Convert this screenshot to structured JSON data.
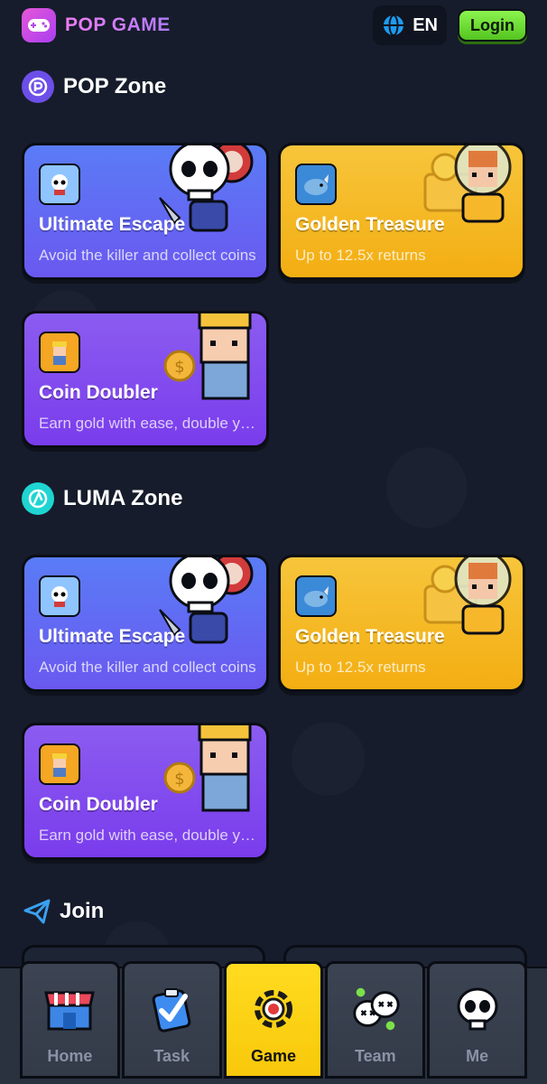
{
  "header": {
    "brand_title": "POP GAME",
    "language": "EN",
    "login_label": "Login"
  },
  "sections": [
    {
      "title": "POP Zone",
      "icon": "pop-zone-icon",
      "games": [
        {
          "name": "Ultimate Escape",
          "desc": "Avoid the killer and collect coins",
          "theme": "blue"
        },
        {
          "name": "Golden Treasure",
          "desc": "Up to 12.5x returns",
          "theme": "gold"
        },
        {
          "name": "Coin Doubler",
          "desc": "Earn gold with ease, double your coins",
          "theme": "purple"
        }
      ]
    },
    {
      "title": "LUMA Zone",
      "icon": "luma-zone-icon",
      "games": [
        {
          "name": "Ultimate Escape",
          "desc": "Avoid the killer and collect coins",
          "theme": "blue"
        },
        {
          "name": "Golden Treasure",
          "desc": "Up to 12.5x returns",
          "theme": "gold"
        },
        {
          "name": "Coin Doubler",
          "desc": "Earn gold with ease, double your coins",
          "theme": "purple"
        }
      ]
    }
  ],
  "join": {
    "title": "Join"
  },
  "nav": {
    "items": [
      {
        "label": "Home",
        "icon": "shop-icon",
        "active": false
      },
      {
        "label": "Task",
        "icon": "clipboard-check-icon",
        "active": false
      },
      {
        "label": "Game",
        "icon": "target-gear-icon",
        "active": true
      },
      {
        "label": "Team",
        "icon": "skulls-icon",
        "active": false
      },
      {
        "label": "Me",
        "icon": "skull-icon",
        "active": false
      }
    ]
  },
  "colors": {
    "background": "#161c2b",
    "accent_green": "#6fdd36",
    "nav_active": "#fcd116",
    "card_blue": "#5a7cf6",
    "card_gold": "#f5b820",
    "card_purple": "#8046ee"
  }
}
